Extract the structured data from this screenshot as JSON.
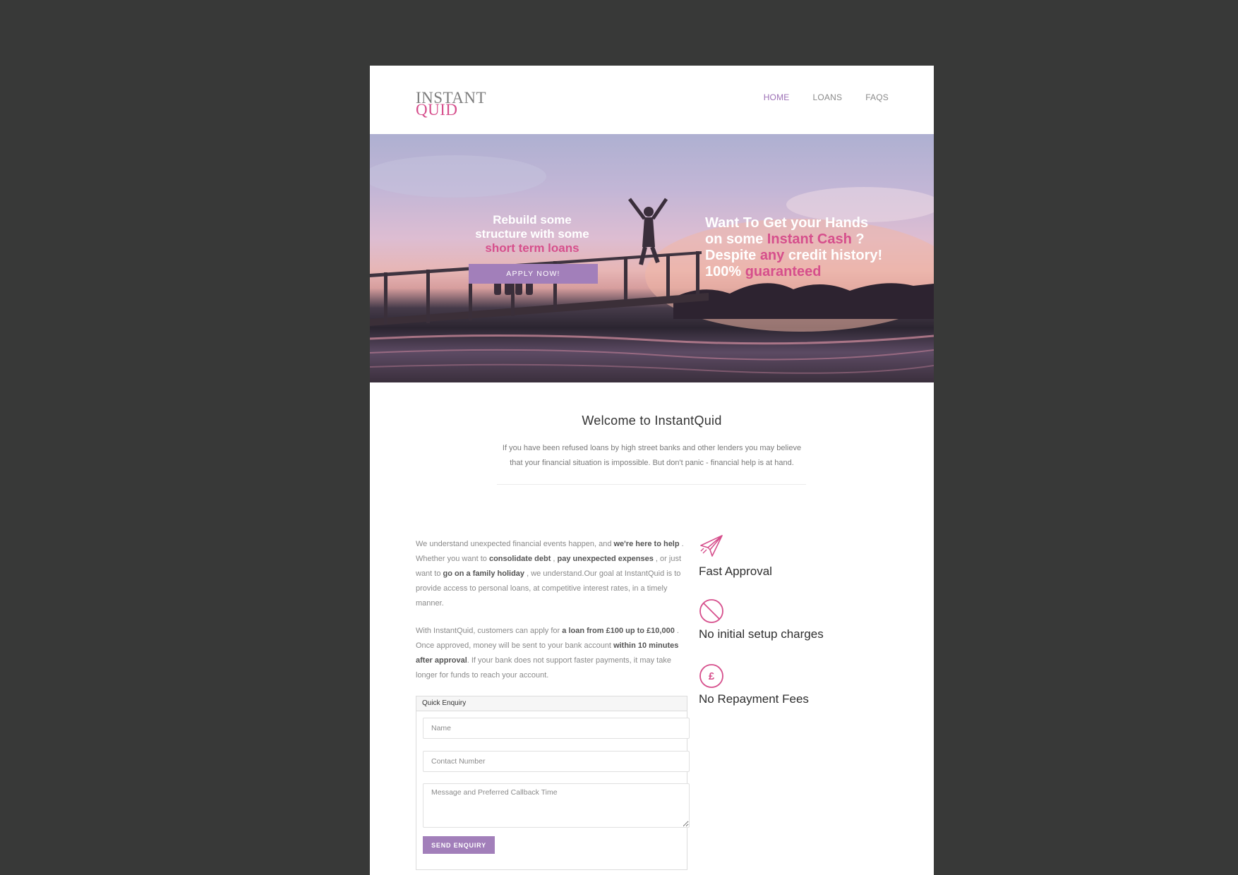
{
  "colors": {
    "background": "#383938",
    "page": "#ffffff",
    "accent_pink": "#d64f8c",
    "accent_purple": "#a27fba"
  },
  "logo": {
    "line1": "INSTANT",
    "line2": "QUID"
  },
  "nav": {
    "home": "HOME",
    "loans": "LOANS",
    "faqs": "FAQS"
  },
  "hero": {
    "left_line1": "Rebuild some",
    "left_line2": "structure with some",
    "left_line3": "short term loans",
    "apply_label": "APPLY NOW!",
    "right_a": "Want To Get your Hands",
    "right_b": "on some ",
    "right_c": "Instant Cash",
    "right_d": " ?",
    "right_e": "Despite ",
    "right_f": "any",
    "right_g": " credit history!",
    "right_h": "100% ",
    "right_i": "guaranteed"
  },
  "welcome": {
    "title": "Welcome to InstantQuid",
    "line1": "If you have been refused loans by high street banks and other lenders you may believe",
    "line2": "that your financial situation is impossible. But don't panic - financial help is at hand."
  },
  "copy": {
    "p1_a": "We understand unexpected financial events happen, and ",
    "p1_b": "we're here to help",
    "p1_c": " . Whether you want to ",
    "p1_d": "consolidate debt",
    "p1_e": " , ",
    "p1_f": "pay unexpected expenses",
    "p1_g": " , or just want to ",
    "p1_h": "go on a family holiday",
    "p1_i": " , we understand.Our goal at InstantQuid is to provide access to personal loans, at competitive interest rates, in a timely manner.",
    "p2_a": "With InstantQuid, customers can apply for ",
    "p2_b": "a loan from £100 up to £10,000",
    "p2_c": " . Once approved, money will be sent to your bank account ",
    "p2_d": "within 10 minutes after approval",
    "p2_e": ". If your bank does not support faster payments, it may take longer for funds to reach your account."
  },
  "features": [
    {
      "icon": "paper-plane-icon",
      "title": "Fast Approval"
    },
    {
      "icon": "prohibited-icon",
      "title": "No initial setup charges"
    },
    {
      "icon": "pound-icon",
      "title": "No Repayment Fees",
      "glyph": "£"
    }
  ],
  "enquiry": {
    "heading": "Quick Enquiry",
    "name_placeholder": "Name",
    "phone_placeholder": "Contact Number",
    "message_placeholder": "Message and Preferred Callback Time",
    "send_label": "SEND ENQUIRY"
  }
}
